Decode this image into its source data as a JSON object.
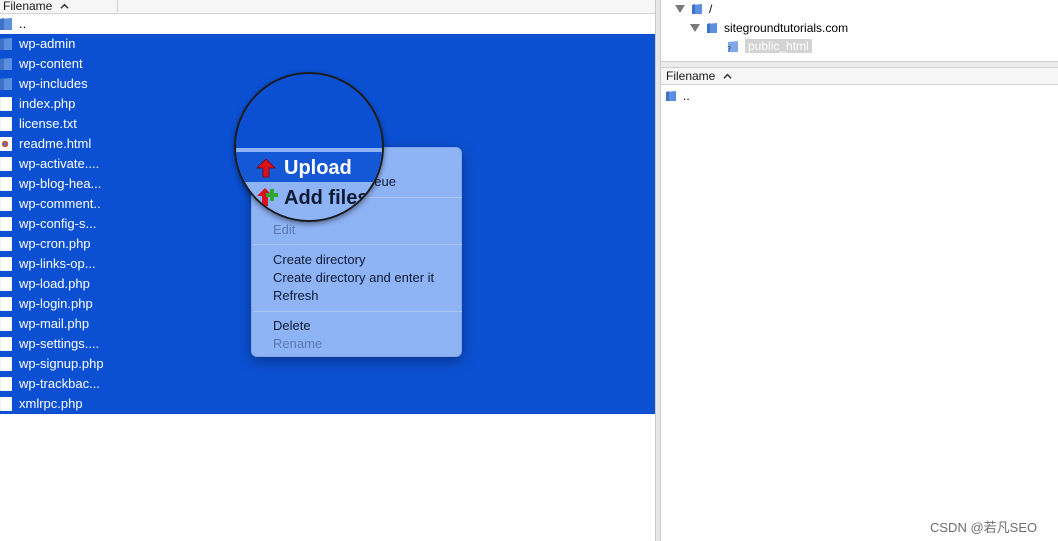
{
  "local": {
    "column_header": "Filename",
    "files": [
      {
        "name": "..",
        "type": "parent"
      },
      {
        "name": "wp-admin",
        "type": "folder"
      },
      {
        "name": "wp-content",
        "type": "folder"
      },
      {
        "name": "wp-includes",
        "type": "folder"
      },
      {
        "name": "index.php",
        "type": "file"
      },
      {
        "name": "license.txt",
        "type": "file"
      },
      {
        "name": "readme.html",
        "type": "html"
      },
      {
        "name": "wp-activate....",
        "type": "file"
      },
      {
        "name": "wp-blog-hea...",
        "type": "file"
      },
      {
        "name": "wp-comment..",
        "type": "file"
      },
      {
        "name": "wp-config-s...",
        "type": "file"
      },
      {
        "name": "wp-cron.php",
        "type": "file"
      },
      {
        "name": "wp-links-op...",
        "type": "file"
      },
      {
        "name": "wp-load.php",
        "type": "file"
      },
      {
        "name": "wp-login.php",
        "type": "file"
      },
      {
        "name": "wp-mail.php",
        "type": "file"
      },
      {
        "name": "wp-settings....",
        "type": "file"
      },
      {
        "name": "wp-signup.php",
        "type": "file"
      },
      {
        "name": "wp-trackbac...",
        "type": "file"
      },
      {
        "name": "xmlrpc.php",
        "type": "file"
      }
    ]
  },
  "remote": {
    "tree": {
      "root": "/",
      "site": "sitegroundtutorials.com",
      "selected": "public_html"
    },
    "column_header": "Filename",
    "files": [
      {
        "name": "..",
        "type": "parent"
      }
    ]
  },
  "context_menu": {
    "items_visible": {
      "queue_fragment": "ueue",
      "edit": "Edit",
      "create_directory": "Create directory",
      "create_directory_enter": "Create directory and enter it",
      "refresh": "Refresh",
      "delete": "Delete",
      "rename": "Rename"
    },
    "magnified": {
      "upload": "Upload",
      "add_files": "Add files"
    }
  },
  "colors": {
    "selection": "#0b50d3",
    "menu_bg": "#8fb4f6",
    "upload_arrow": "#d8121c",
    "folder": "#5b8fe0"
  },
  "watermark": "CSDN @若凡SEO"
}
